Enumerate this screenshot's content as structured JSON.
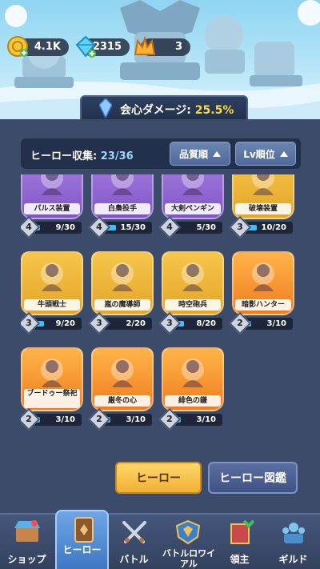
{
  "resources": [
    {
      "icon": "gold-coin-icon",
      "value": "4.1K"
    },
    {
      "icon": "blue-gem-icon",
      "value": "2315"
    },
    {
      "icon": "crown-icon",
      "value": "3"
    }
  ],
  "crit_banner": {
    "label": "会心ダメージ:",
    "value": "25.5%"
  },
  "collection": {
    "label": "ヒーロー収集:",
    "count": "23/36",
    "sort_quality": "品質順",
    "sort_level": "Lv順位"
  },
  "heroes": [
    {
      "name": "パルス装置",
      "level": "4",
      "progress": "9/30",
      "fill": 0.3,
      "rarity": "purple"
    },
    {
      "name": "白梟投手",
      "level": "4",
      "progress": "15/30",
      "fill": 0.5,
      "rarity": "purple"
    },
    {
      "name": "大剣ペンギン",
      "level": "4",
      "progress": "5/30",
      "fill": 0.17,
      "rarity": "purple"
    },
    {
      "name": "破壊装置",
      "level": "3",
      "progress": "10/20",
      "fill": 0.5,
      "rarity": "gold"
    },
    {
      "name": "牛頭戦士",
      "level": "3",
      "progress": "9/20",
      "fill": 0.45,
      "rarity": "gold"
    },
    {
      "name": "嵐の魔導師",
      "level": "3",
      "progress": "2/20",
      "fill": 0.1,
      "rarity": "gold"
    },
    {
      "name": "時空砲兵",
      "level": "3",
      "progress": "8/20",
      "fill": 0.4,
      "rarity": "gold"
    },
    {
      "name": "暗影ハンター",
      "level": "2",
      "progress": "3/10",
      "fill": 0.3,
      "rarity": "orange"
    },
    {
      "name": "ブードゥー祭祀",
      "level": "2",
      "progress": "3/10",
      "fill": 0.3,
      "rarity": "orange"
    },
    {
      "name": "厳冬の心",
      "level": "2",
      "progress": "3/10",
      "fill": 0.3,
      "rarity": "orange"
    },
    {
      "name": "緋色の鎌",
      "level": "2",
      "progress": "3/10",
      "fill": 0.3,
      "rarity": "orange"
    }
  ],
  "buttons": {
    "hero": "ヒーロー",
    "dex": "ヒーロー図鑑"
  },
  "tabs": [
    {
      "label": "ショップ",
      "icon": "shop-icon"
    },
    {
      "label": "ヒーロー",
      "icon": "hero-card-icon",
      "active": true
    },
    {
      "label": "バトル",
      "icon": "crossed-swords-icon"
    },
    {
      "label": "バトルロワイアル",
      "icon": "royale-shield-icon"
    },
    {
      "label": "領主",
      "icon": "lord-banner-icon"
    },
    {
      "label": "ギルド",
      "icon": "guild-icon"
    }
  ]
}
